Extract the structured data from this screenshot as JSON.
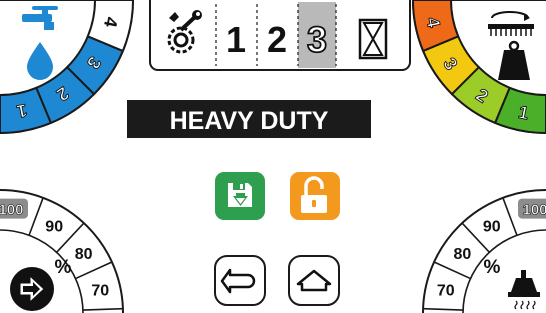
{
  "header": {
    "mode_buttons": [
      {
        "id": "settings",
        "icon": "gear-wrench-icon"
      },
      {
        "id": "program-1",
        "label": "1",
        "selected": false
      },
      {
        "id": "program-2",
        "label": "2",
        "selected": false
      },
      {
        "id": "program-3",
        "label": "3",
        "selected": true
      },
      {
        "id": "timer",
        "icon": "hourglass-icon"
      }
    ]
  },
  "program_name": "HEAVY DUTY",
  "actions": [
    {
      "id": "save",
      "icon": "save-icon",
      "color": "#2e9e4f"
    },
    {
      "id": "unlock",
      "icon": "unlock-icon",
      "color": "#f39a1e"
    }
  ],
  "nav": [
    {
      "id": "back",
      "icon": "back-arrow-icon"
    },
    {
      "id": "home",
      "icon": "home-icon"
    }
  ],
  "water_gauge": {
    "icon": "water-tap-icon",
    "levels": [
      "1",
      "2",
      "3",
      "4"
    ],
    "active_level": 3,
    "colors": [
      "#1e88d2",
      "#1e88d2",
      "#1e88d2",
      "#ffffff"
    ]
  },
  "weight_gauge": {
    "icon": "weight-brush-icon",
    "levels": [
      "1",
      "2",
      "3",
      "4"
    ],
    "colors": [
      "#4caf2a",
      "#9ccc27",
      "#f2c811",
      "#ef6a18"
    ]
  },
  "left_percent_dial": {
    "icon": "play-arrow-icon",
    "unit": "%",
    "ticks": [
      "100",
      "90",
      "80",
      "70"
    ]
  },
  "right_percent_dial": {
    "icon": "heater-icon",
    "unit": "%",
    "ticks": [
      "100",
      "90",
      "80",
      "70"
    ]
  }
}
